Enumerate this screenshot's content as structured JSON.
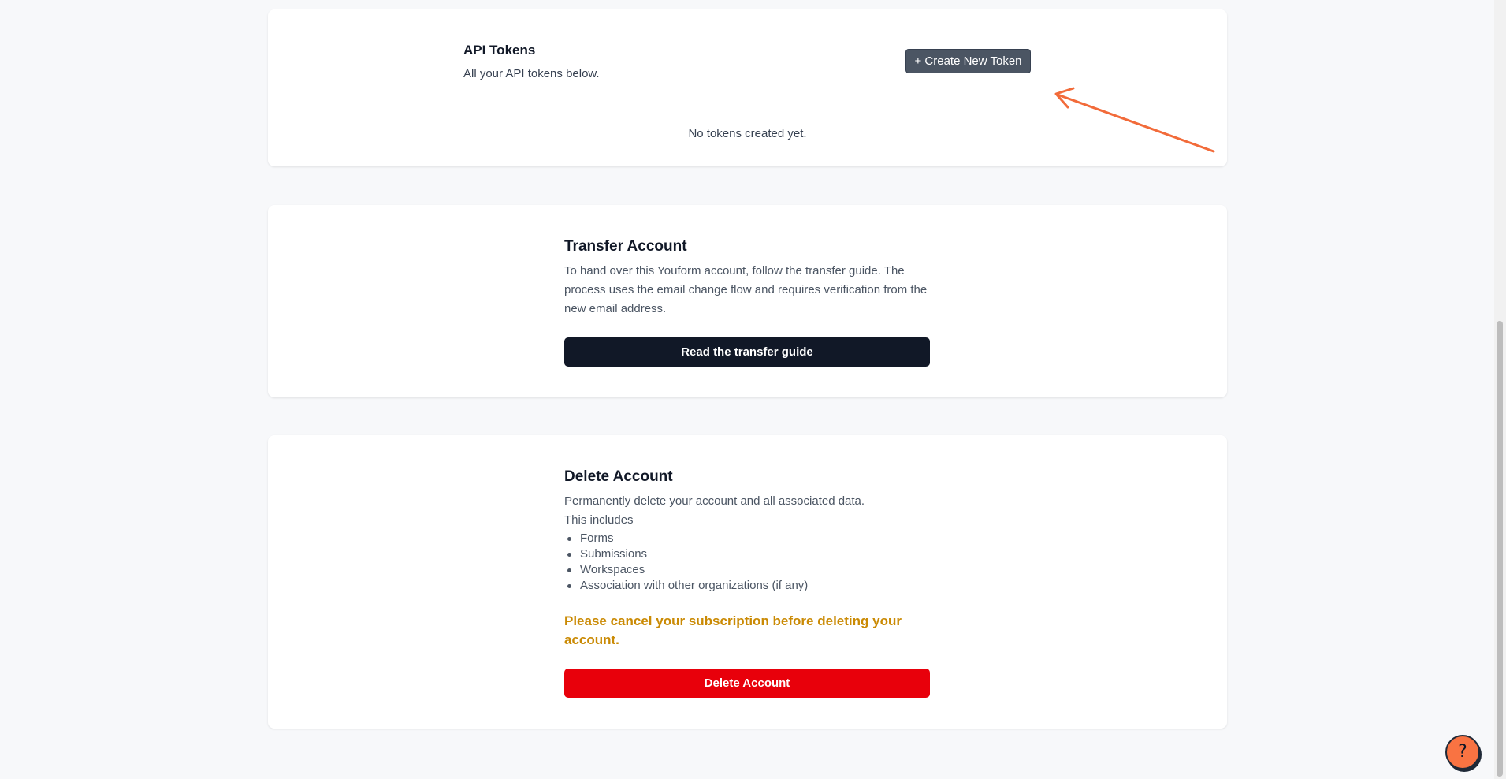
{
  "api_tokens": {
    "title": "API Tokens",
    "subtitle": "All your API tokens below.",
    "create_button": "+ Create New Token",
    "empty_message": "No tokens created yet."
  },
  "transfer": {
    "title": "Transfer Account",
    "description": "To hand over this Youform account, follow the transfer guide. The process uses the email change flow and requires verification from the new email address.",
    "button": "Read the transfer guide"
  },
  "delete": {
    "title": "Delete Account",
    "description": "Permanently delete your account and all associated data.",
    "includes_label": "This includes",
    "items": [
      "Forms",
      "Submissions",
      "Workspaces",
      "Association with other organizations (if any)"
    ],
    "warning": "Please cancel your subscription before deleting your account.",
    "button": "Delete Account"
  },
  "help": {
    "icon": "question-mark-icon",
    "label": "?"
  },
  "colors": {
    "arrow": "#f26b3a",
    "warning": "#ca8a04",
    "delete_button": "#e8000b",
    "dark_button": "#111827",
    "help_bubble": "#f97342"
  }
}
